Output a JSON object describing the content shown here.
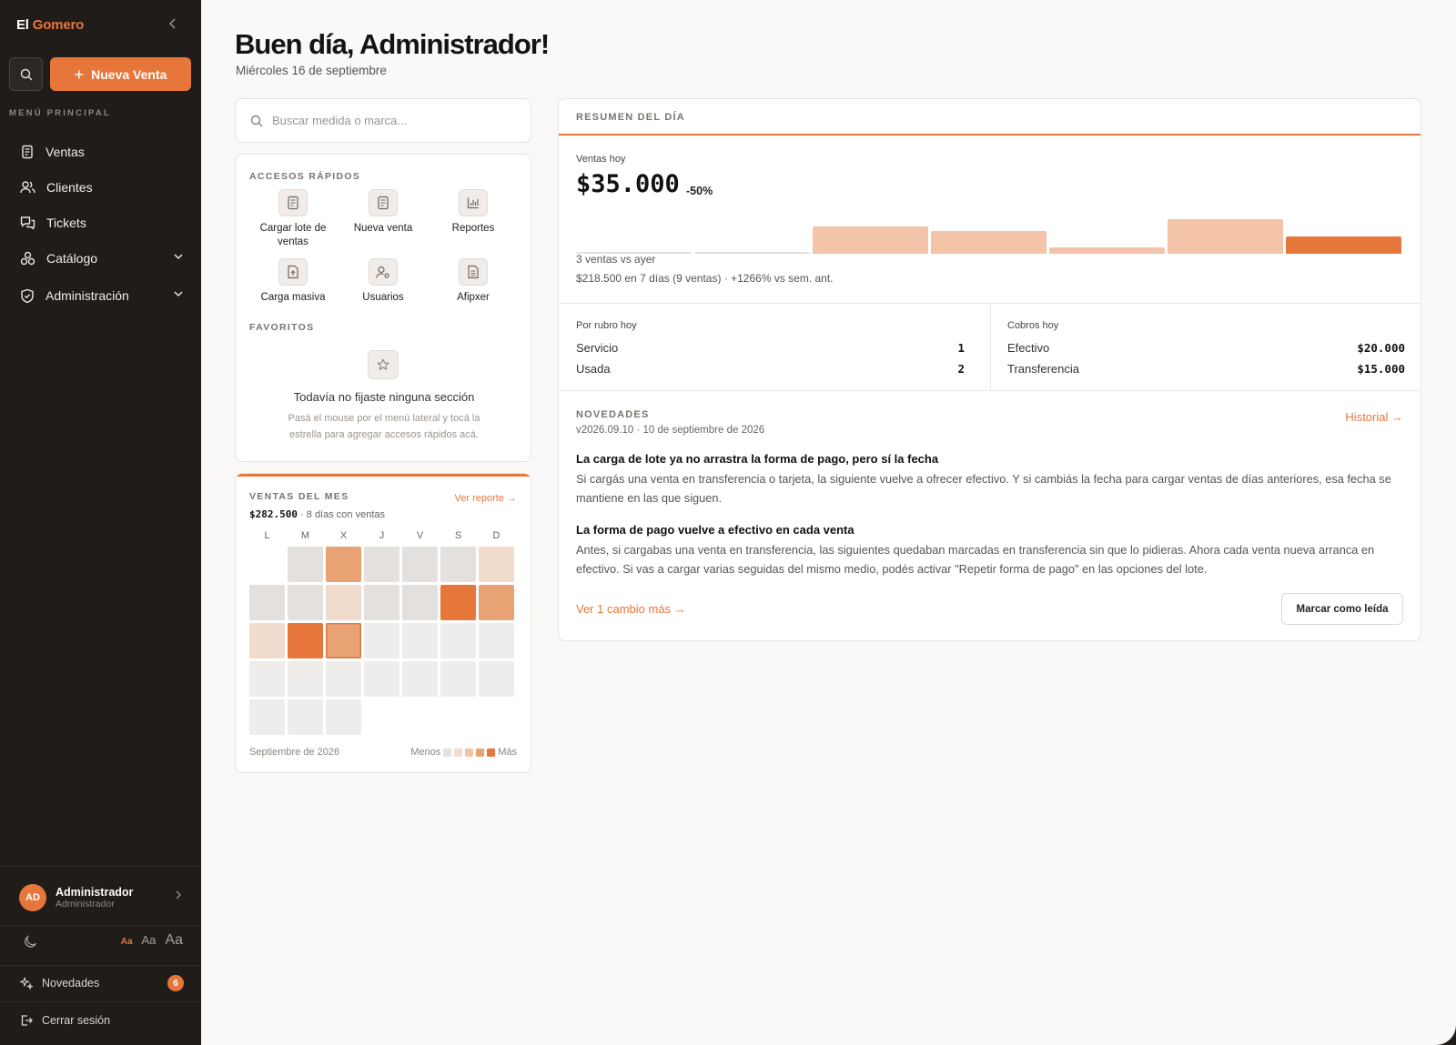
{
  "sidebar": {
    "brand_first": "El",
    "brand_second": "Gomero",
    "new_sale_label": "Nueva Venta",
    "menu_heading": "MENÚ PRINCIPAL",
    "nav": [
      {
        "label": "Ventas",
        "icon": "receipt-icon"
      },
      {
        "label": "Clientes",
        "icon": "users-icon"
      },
      {
        "label": "Tickets",
        "icon": "chat-icon"
      },
      {
        "label": "Catálogo",
        "icon": "boxes-icon",
        "expandable": true
      },
      {
        "label": "Administración",
        "icon": "shield-icon",
        "expandable": true
      }
    ],
    "user": {
      "initials": "AD",
      "name": "Administrador",
      "role": "Administrador"
    },
    "font_sizes": [
      "Aa",
      "Aa",
      "Aa"
    ],
    "novedades_label": "Novedades",
    "novedades_count": "6",
    "logout_label": "Cerrar sesión"
  },
  "header": {
    "greeting": "Buen día, Administrador!",
    "date": "Miércoles 16 de septiembre"
  },
  "search": {
    "placeholder": "Buscar medida o marca..."
  },
  "quick_access": {
    "heading": "ACCESOS RÁPIDOS",
    "items": [
      {
        "label": "Cargar lote de ventas",
        "icon": "document-icon"
      },
      {
        "label": "Nueva venta",
        "icon": "document-icon"
      },
      {
        "label": "Reportes",
        "icon": "bar-chart-icon"
      },
      {
        "label": "Carga masiva",
        "icon": "upload-file-icon"
      },
      {
        "label": "Usuarios",
        "icon": "user-settings-icon"
      },
      {
        "label": "Afipxer",
        "icon": "invoice-icon"
      }
    ],
    "favorites_heading": "FAVORITOS",
    "favorites_empty_title": "Todavía no fijaste ninguna sección",
    "favorites_empty_desc": "Pasá el mouse por el menú lateral y tocá la estrella para agregar accesos rápidos acá."
  },
  "month_sales": {
    "heading": "VENTAS DEL MES",
    "total": "$282.500",
    "days_text": "· 8 días con ventas",
    "report_link": "Ver reporte →",
    "weekdays": [
      "L",
      "M",
      "X",
      "J",
      "V",
      "S",
      "D"
    ],
    "first_weekday_offset": 1,
    "today_day": 16,
    "levels": [
      0,
      3,
      0,
      0,
      0,
      1,
      0,
      0,
      1,
      0,
      0,
      4,
      3,
      1,
      4,
      3
    ],
    "future_days": 14,
    "month_label": "Septiembre de 2026",
    "legend_less": "Menos",
    "legend_more": "Más"
  },
  "summary": {
    "heading": "RESUMEN DEL DÍA",
    "ventas_label": "Ventas hoy",
    "ventas_value": "$35.000",
    "ventas_pct": "-50%",
    "daily_bars": [
      0.02,
      0.02,
      0.78,
      0.65,
      0.18,
      1.0,
      0.5
    ],
    "vs_ayer": "3 ventas vs ayer",
    "week_summary": "$218.500 en 7 días (9 ventas) · +1266% vs sem. ant.",
    "rubro_heading": "Por rubro hoy",
    "rubros": [
      {
        "label": "Servicio",
        "value": "1"
      },
      {
        "label": "Usada",
        "value": "2"
      }
    ],
    "cobros_heading": "Cobros hoy",
    "cobros": [
      {
        "label": "Efectivo",
        "value": "$20.000"
      },
      {
        "label": "Transferencia",
        "value": "$15.000"
      }
    ]
  },
  "news": {
    "heading": "NOVEDADES",
    "version": "v2026.09.10 · 10 de septiembre de 2026",
    "history_link": "Historial →",
    "items": [
      {
        "title": "La carga de lote ya no arrastra la forma de pago, pero sí la fecha",
        "body": "Si cargás una venta en transferencia o tarjeta, la siguiente vuelve a ofrecer efectivo. Y si cambiás la fecha para cargar ventas de días anteriores, esa fecha se mantiene en las que siguen."
      },
      {
        "title": "La forma de pago vuelve a efectivo en cada venta",
        "body": "Antes, si cargabas una venta en transferencia, las siguientes quedaban marcadas en transferencia sin que lo pidieras. Ahora cada venta nueva arranca en efectivo. Si vas a cargar varias seguidas del mismo medio, podés activar \"Repetir forma de pago\" en las opciones del lote."
      }
    ],
    "more_link": "Ver 1 cambio más →",
    "mark_read": "Marcar como leída"
  },
  "colors": {
    "accent": "#e6763a",
    "level_0": "#e3e0dd",
    "level_1": "#f0dbcd",
    "level_2": "#f3c4a8",
    "level_3": "#e9a273",
    "level_4": "#e6763a",
    "future": "#efedeb"
  }
}
